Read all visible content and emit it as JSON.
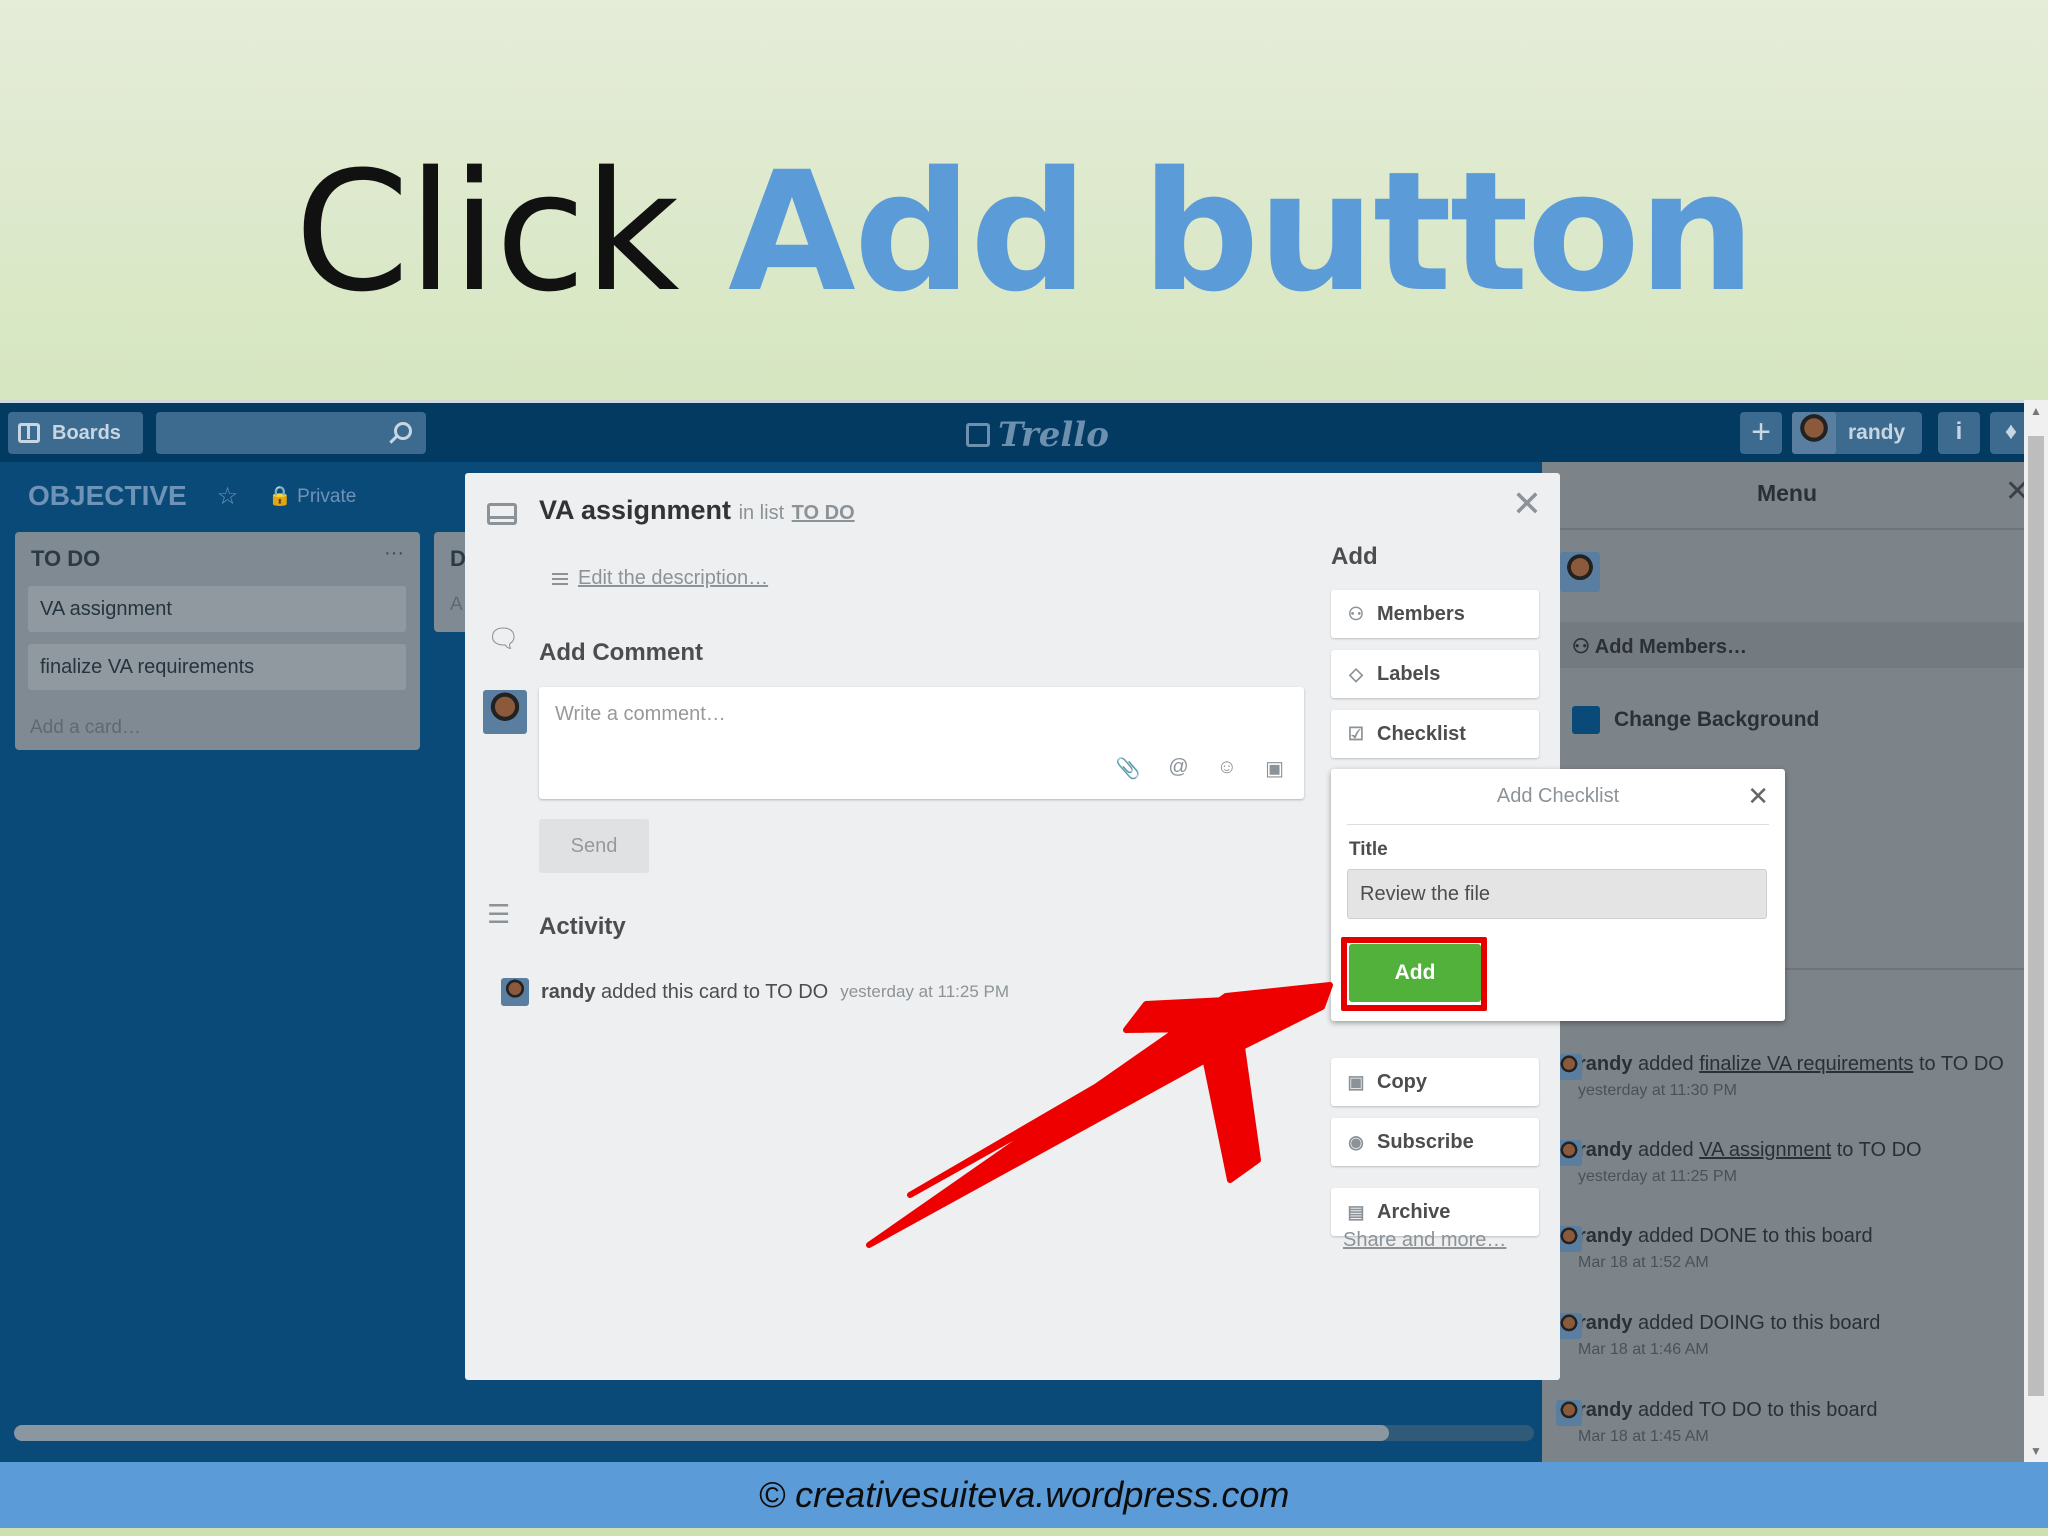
{
  "banner": {
    "title_part1": "Click ",
    "title_part2": "Add button"
  },
  "topbar": {
    "boards_label": "Boards",
    "logo": "Trello",
    "plus": "+",
    "username": "randy",
    "info": "i"
  },
  "board": {
    "name": "OBJECTIVE",
    "visibility": "Private"
  },
  "lists": [
    {
      "title": "TO DO",
      "cards": [
        "VA assignment",
        "finalize VA requirements"
      ],
      "add_card": "Add a card…"
    },
    {
      "title": "D",
      "cards": [
        "A"
      ]
    }
  ],
  "dialog": {
    "card_name": "VA assignment",
    "in_list_prefix": "in list",
    "list_name": "TO DO",
    "edit_description": "Edit the description…",
    "add_comment_heading": "Add Comment",
    "comment_placeholder": "Write a comment…",
    "send_label": "Send",
    "activity_heading": "Activity",
    "activity": {
      "user": "randy",
      "text": "added this card to TO DO",
      "when": "yesterday at 11:25 PM"
    }
  },
  "sidebar": {
    "add_heading": "Add",
    "buttons": {
      "members": "Members",
      "labels": "Labels",
      "checklist": "Checklist",
      "copy": "Copy",
      "subscribe": "Subscribe",
      "archive": "Archive"
    },
    "share_link": "Share and more…"
  },
  "popover": {
    "title": "Add Checklist",
    "field_label": "Title",
    "field_value": "Review the file",
    "add_label": "Add"
  },
  "menu": {
    "title": "Menu",
    "add_members": "Add Members…",
    "change_background": "Change Background",
    "background_color": "#0a4a78",
    "activity": [
      {
        "user": "randy",
        "pre": "added",
        "link": "finalize VA requirements",
        "post": "to TO DO",
        "when": "yesterday at 11:30 PM"
      },
      {
        "user": "randy",
        "pre": "added",
        "link": "VA assignment",
        "post": "to TO DO",
        "when": "yesterday at 11:25 PM"
      },
      {
        "user": "randy",
        "pre": "added DONE to this board",
        "link": "",
        "post": "",
        "when": "Mar 18 at 1:52 AM"
      },
      {
        "user": "randy",
        "pre": "added DOING to this board",
        "link": "",
        "post": "",
        "when": "Mar 18 at 1:46 AM"
      },
      {
        "user": "randy",
        "pre": "added TO DO to this board",
        "link": "",
        "post": "",
        "when": "Mar 18 at 1:45 AM"
      }
    ]
  },
  "footer": {
    "text": "© creativesuiteva.wordpress.com"
  },
  "colors": {
    "accent": "#5b9bd8",
    "add_button": "#52b13b",
    "highlight": "#e50000"
  }
}
